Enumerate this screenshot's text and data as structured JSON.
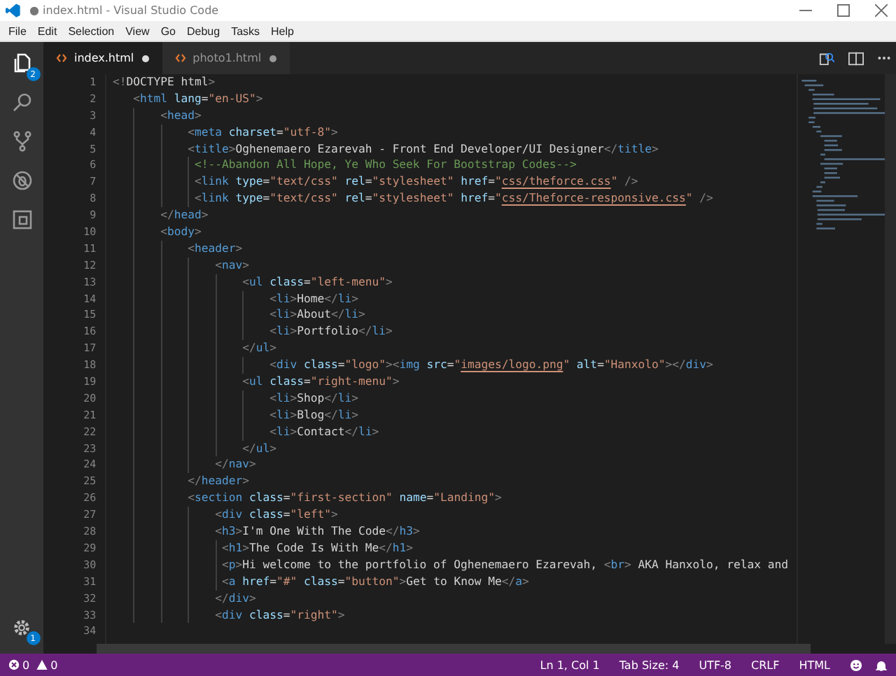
{
  "window": {
    "title": "● index.html - Visual Studio Code"
  },
  "menu": [
    "File",
    "Edit",
    "Selection",
    "View",
    "Go",
    "Debug",
    "Tasks",
    "Help"
  ],
  "activity_bar": [
    {
      "kind": "files",
      "badge": "2",
      "selected": true
    },
    {
      "kind": "search",
      "selected": false
    },
    {
      "kind": "source-control",
      "selected": false
    },
    {
      "kind": "debug",
      "selected": false
    },
    {
      "kind": "extensions",
      "selected": false
    }
  ],
  "settings": {
    "badge": "1"
  },
  "tabs": [
    {
      "label": "index.html",
      "selected": true,
      "modified": true
    },
    {
      "label": "photo1.html",
      "selected": false,
      "modified": true
    }
  ],
  "lines": [
    {
      "num": "1",
      "tokens": [
        {
          "kind": "punct",
          "text": " <!"
        },
        {
          "kind": "text",
          "text": "DOCTYPE html"
        },
        {
          "kind": "punct",
          "text": ">"
        }
      ]
    },
    {
      "num": "2",
      "tokens": [
        {
          "kind": "punct",
          "text": "    <"
        },
        {
          "kind": "tag",
          "text": "html"
        },
        {
          "kind": "attr",
          "text": " lang"
        },
        {
          "kind": "eq",
          "text": "="
        },
        {
          "kind": "str",
          "text": "\"en-US\""
        },
        {
          "kind": "punct",
          "text": ">"
        }
      ]
    },
    {
      "num": "3",
      "tokens": [
        {
          "kind": "punct",
          "text": "        <"
        },
        {
          "kind": "tag",
          "text": "head"
        },
        {
          "kind": "punct",
          "text": ">"
        }
      ]
    },
    {
      "num": "4",
      "tokens": [
        {
          "kind": "punct",
          "text": "            <"
        },
        {
          "kind": "tag",
          "text": "meta"
        },
        {
          "kind": "attr",
          "text": " charset"
        },
        {
          "kind": "eq",
          "text": "="
        },
        {
          "kind": "str",
          "text": "\"utf-8\""
        },
        {
          "kind": "punct",
          "text": ">"
        }
      ]
    },
    {
      "num": "5",
      "tokens": [
        {
          "kind": "punct",
          "text": "            <"
        },
        {
          "kind": "tag",
          "text": "title"
        },
        {
          "kind": "punct",
          "text": ">"
        },
        {
          "kind": "text",
          "text": "Oghenemaero Ezarevah - Front End Developer/UI Designer"
        },
        {
          "kind": "punct",
          "text": "</"
        },
        {
          "kind": "tag",
          "text": "title"
        },
        {
          "kind": "punct",
          "text": ">"
        }
      ]
    },
    {
      "num": "6",
      "tokens": [
        {
          "kind": "comment",
          "text": "             <!--Abandon All Hope, Ye Who Seek For Bootstrap Codes-->"
        }
      ]
    },
    {
      "num": "7",
      "tokens": [
        {
          "kind": "punct",
          "text": "             <"
        },
        {
          "kind": "tag",
          "text": "link"
        },
        {
          "kind": "attr",
          "text": " type"
        },
        {
          "kind": "eq",
          "text": "="
        },
        {
          "kind": "str",
          "text": "\"text/css\""
        },
        {
          "kind": "attr",
          "text": " rel"
        },
        {
          "kind": "eq",
          "text": "="
        },
        {
          "kind": "str",
          "text": "\"stylesheet\""
        },
        {
          "kind": "attr",
          "text": " href"
        },
        {
          "kind": "eq",
          "text": "="
        },
        {
          "kind": "str",
          "text": "\""
        },
        {
          "kind": "link",
          "text": "css/theforce.css"
        },
        {
          "kind": "str",
          "text": "\""
        },
        {
          "kind": "punct",
          "text": " />"
        }
      ]
    },
    {
      "num": "8",
      "tokens": [
        {
          "kind": "punct",
          "text": "             <"
        },
        {
          "kind": "tag",
          "text": "link"
        },
        {
          "kind": "attr",
          "text": " type"
        },
        {
          "kind": "eq",
          "text": "="
        },
        {
          "kind": "str",
          "text": "\"text/css\""
        },
        {
          "kind": "attr",
          "text": " rel"
        },
        {
          "kind": "eq",
          "text": "="
        },
        {
          "kind": "str",
          "text": "\"stylesheet\""
        },
        {
          "kind": "attr",
          "text": " href"
        },
        {
          "kind": "eq",
          "text": "="
        },
        {
          "kind": "str",
          "text": "\""
        },
        {
          "kind": "link",
          "text": "css/Theforce-responsive.css"
        },
        {
          "kind": "str",
          "text": "\""
        },
        {
          "kind": "punct",
          "text": " />"
        }
      ]
    },
    {
      "num": "9",
      "tokens": [
        {
          "kind": "punct",
          "text": "        </"
        },
        {
          "kind": "tag",
          "text": "head"
        },
        {
          "kind": "punct",
          "text": ">"
        }
      ]
    },
    {
      "num": "10",
      "tokens": [
        {
          "kind": "punct",
          "text": "        <"
        },
        {
          "kind": "tag",
          "text": "body"
        },
        {
          "kind": "punct",
          "text": ">"
        }
      ]
    },
    {
      "num": "11",
      "tokens": [
        {
          "kind": "punct",
          "text": "            <"
        },
        {
          "kind": "tag",
          "text": "header"
        },
        {
          "kind": "punct",
          "text": ">"
        }
      ]
    },
    {
      "num": "12",
      "tokens": [
        {
          "kind": "punct",
          "text": "                <"
        },
        {
          "kind": "tag",
          "text": "nav"
        },
        {
          "kind": "punct",
          "text": ">"
        }
      ]
    },
    {
      "num": "13",
      "tokens": [
        {
          "kind": "punct",
          "text": "                    <"
        },
        {
          "kind": "tag",
          "text": "ul"
        },
        {
          "kind": "attr",
          "text": " class"
        },
        {
          "kind": "eq",
          "text": "="
        },
        {
          "kind": "str",
          "text": "\"left-menu\""
        },
        {
          "kind": "punct",
          "text": ">"
        }
      ]
    },
    {
      "num": "14",
      "tokens": [
        {
          "kind": "punct",
          "text": "                        <"
        },
        {
          "kind": "tag",
          "text": "li"
        },
        {
          "kind": "punct",
          "text": ">"
        },
        {
          "kind": "text",
          "text": "Home"
        },
        {
          "kind": "punct",
          "text": "</"
        },
        {
          "kind": "tag",
          "text": "li"
        },
        {
          "kind": "punct",
          "text": ">"
        }
      ]
    },
    {
      "num": "15",
      "tokens": [
        {
          "kind": "punct",
          "text": "                        <"
        },
        {
          "kind": "tag",
          "text": "li"
        },
        {
          "kind": "punct",
          "text": ">"
        },
        {
          "kind": "text",
          "text": "About"
        },
        {
          "kind": "punct",
          "text": "</"
        },
        {
          "kind": "tag",
          "text": "li"
        },
        {
          "kind": "punct",
          "text": ">"
        }
      ]
    },
    {
      "num": "16",
      "tokens": [
        {
          "kind": "punct",
          "text": "                        <"
        },
        {
          "kind": "tag",
          "text": "li"
        },
        {
          "kind": "punct",
          "text": ">"
        },
        {
          "kind": "text",
          "text": "Portfolio"
        },
        {
          "kind": "punct",
          "text": "</"
        },
        {
          "kind": "tag",
          "text": "li"
        },
        {
          "kind": "punct",
          "text": ">"
        }
      ]
    },
    {
      "num": "17",
      "tokens": [
        {
          "kind": "punct",
          "text": "                    </"
        },
        {
          "kind": "tag",
          "text": "ul"
        },
        {
          "kind": "punct",
          "text": ">"
        }
      ]
    },
    {
      "num": "18",
      "tokens": [
        {
          "kind": "punct",
          "text": "                        <"
        },
        {
          "kind": "tag",
          "text": "div"
        },
        {
          "kind": "attr",
          "text": " class"
        },
        {
          "kind": "eq",
          "text": "="
        },
        {
          "kind": "str",
          "text": "\"logo\""
        },
        {
          "kind": "punct",
          "text": "><"
        },
        {
          "kind": "tag",
          "text": "img"
        },
        {
          "kind": "attr",
          "text": " src"
        },
        {
          "kind": "eq",
          "text": "="
        },
        {
          "kind": "str",
          "text": "\""
        },
        {
          "kind": "link",
          "text": "images/logo.png"
        },
        {
          "kind": "str",
          "text": "\""
        },
        {
          "kind": "attr",
          "text": " alt"
        },
        {
          "kind": "eq",
          "text": "="
        },
        {
          "kind": "str",
          "text": "\"Hanxolo\""
        },
        {
          "kind": "punct",
          "text": "></"
        },
        {
          "kind": "tag",
          "text": "div"
        },
        {
          "kind": "punct",
          "text": ">"
        }
      ]
    },
    {
      "num": "19",
      "tokens": [
        {
          "kind": "punct",
          "text": "                    <"
        },
        {
          "kind": "tag",
          "text": "ul"
        },
        {
          "kind": "attr",
          "text": " class"
        },
        {
          "kind": "eq",
          "text": "="
        },
        {
          "kind": "str",
          "text": "\"right-menu\""
        },
        {
          "kind": "punct",
          "text": ">"
        }
      ]
    },
    {
      "num": "20",
      "tokens": [
        {
          "kind": "punct",
          "text": "                        <"
        },
        {
          "kind": "tag",
          "text": "li"
        },
        {
          "kind": "punct",
          "text": ">"
        },
        {
          "kind": "text",
          "text": "Shop"
        },
        {
          "kind": "punct",
          "text": "</"
        },
        {
          "kind": "tag",
          "text": "li"
        },
        {
          "kind": "punct",
          "text": ">"
        }
      ]
    },
    {
      "num": "21",
      "tokens": [
        {
          "kind": "punct",
          "text": "                        <"
        },
        {
          "kind": "tag",
          "text": "li"
        },
        {
          "kind": "punct",
          "text": ">"
        },
        {
          "kind": "text",
          "text": "Blog"
        },
        {
          "kind": "punct",
          "text": "</"
        },
        {
          "kind": "tag",
          "text": "li"
        },
        {
          "kind": "punct",
          "text": ">"
        }
      ]
    },
    {
      "num": "22",
      "tokens": [
        {
          "kind": "punct",
          "text": "                        <"
        },
        {
          "kind": "tag",
          "text": "li"
        },
        {
          "kind": "punct",
          "text": ">"
        },
        {
          "kind": "text",
          "text": "Contact"
        },
        {
          "kind": "punct",
          "text": "</"
        },
        {
          "kind": "tag",
          "text": "li"
        },
        {
          "kind": "punct",
          "text": ">"
        }
      ]
    },
    {
      "num": "23",
      "tokens": [
        {
          "kind": "punct",
          "text": "                    </"
        },
        {
          "kind": "tag",
          "text": "ul"
        },
        {
          "kind": "punct",
          "text": ">"
        }
      ]
    },
    {
      "num": "24",
      "tokens": [
        {
          "kind": "punct",
          "text": "                </"
        },
        {
          "kind": "tag",
          "text": "nav"
        },
        {
          "kind": "punct",
          "text": ">"
        }
      ]
    },
    {
      "num": "25",
      "tokens": [
        {
          "kind": "punct",
          "text": "            </"
        },
        {
          "kind": "tag",
          "text": "header"
        },
        {
          "kind": "punct",
          "text": ">"
        }
      ]
    },
    {
      "num": "26",
      "tokens": [
        {
          "kind": "punct",
          "text": "            <"
        },
        {
          "kind": "tag",
          "text": "section"
        },
        {
          "kind": "attr",
          "text": " class"
        },
        {
          "kind": "eq",
          "text": "="
        },
        {
          "kind": "str",
          "text": "\"first-section\""
        },
        {
          "kind": "attr",
          "text": " name"
        },
        {
          "kind": "eq",
          "text": "="
        },
        {
          "kind": "str",
          "text": "\"Landing\""
        },
        {
          "kind": "punct",
          "text": ">"
        }
      ]
    },
    {
      "num": "27",
      "tokens": [
        {
          "kind": "punct",
          "text": "                <"
        },
        {
          "kind": "tag",
          "text": "div"
        },
        {
          "kind": "attr",
          "text": " class"
        },
        {
          "kind": "eq",
          "text": "="
        },
        {
          "kind": "str",
          "text": "\"left\""
        },
        {
          "kind": "punct",
          "text": ">"
        }
      ]
    },
    {
      "num": "28",
      "tokens": [
        {
          "kind": "punct",
          "text": "                <"
        },
        {
          "kind": "tag",
          "text": "h3"
        },
        {
          "kind": "punct",
          "text": ">"
        },
        {
          "kind": "text",
          "text": "I'm One With The Code"
        },
        {
          "kind": "punct",
          "text": "</"
        },
        {
          "kind": "tag",
          "text": "h3"
        },
        {
          "kind": "punct",
          "text": ">"
        }
      ]
    },
    {
      "num": "29",
      "tokens": [
        {
          "kind": "punct",
          "text": "                 <"
        },
        {
          "kind": "tag",
          "text": "h1"
        },
        {
          "kind": "punct",
          "text": ">"
        },
        {
          "kind": "text",
          "text": "The Code Is With Me"
        },
        {
          "kind": "punct",
          "text": "</"
        },
        {
          "kind": "tag",
          "text": "h1"
        },
        {
          "kind": "punct",
          "text": ">"
        }
      ]
    },
    {
      "num": "30",
      "tokens": [
        {
          "kind": "punct",
          "text": "                 <"
        },
        {
          "kind": "tag",
          "text": "p"
        },
        {
          "kind": "punct",
          "text": ">"
        },
        {
          "kind": "text",
          "text": "Hi welcome to the portfolio of Oghenemaero Ezarevah, "
        },
        {
          "kind": "punct",
          "text": "<"
        },
        {
          "kind": "tag",
          "text": "br"
        },
        {
          "kind": "punct",
          "text": ">"
        },
        {
          "kind": "text",
          "text": " AKA Hanxolo, relax and"
        }
      ]
    },
    {
      "num": "31",
      "tokens": [
        {
          "kind": "punct",
          "text": "                 <"
        },
        {
          "kind": "tag",
          "text": "a"
        },
        {
          "kind": "attr",
          "text": " href"
        },
        {
          "kind": "eq",
          "text": "="
        },
        {
          "kind": "str",
          "text": "\"#\""
        },
        {
          "kind": "attr",
          "text": " class"
        },
        {
          "kind": "eq",
          "text": "="
        },
        {
          "kind": "str",
          "text": "\"button\""
        },
        {
          "kind": "punct",
          "text": ">"
        },
        {
          "kind": "text",
          "text": "Get to Know Me"
        },
        {
          "kind": "punct",
          "text": "</"
        },
        {
          "kind": "tag",
          "text": "a"
        },
        {
          "kind": "punct",
          "text": ">"
        }
      ]
    },
    {
      "num": "32",
      "tokens": [
        {
          "kind": "punct",
          "text": "                </"
        },
        {
          "kind": "tag",
          "text": "div"
        },
        {
          "kind": "punct",
          "text": ">"
        }
      ]
    },
    {
      "num": "33",
      "tokens": [
        {
          "kind": "punct",
          "text": "                <"
        },
        {
          "kind": "tag",
          "text": "div"
        },
        {
          "kind": "attr",
          "text": " class"
        },
        {
          "kind": "eq",
          "text": "="
        },
        {
          "kind": "str",
          "text": "\"right\""
        },
        {
          "kind": "punct",
          "text": ">"
        }
      ]
    },
    {
      "num": "34"
    }
  ],
  "status_bar": {
    "errors": "0",
    "warnings": "0",
    "items": [
      "Ln 1, Col 1",
      "Tab Size: 4",
      "UTF-8",
      "CRLF",
      "HTML"
    ]
  }
}
